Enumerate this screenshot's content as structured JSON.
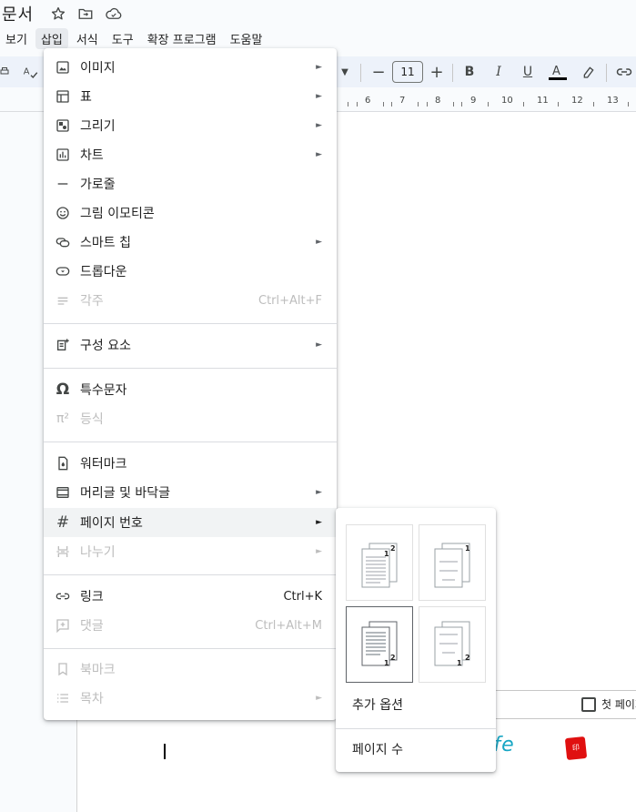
{
  "doc": {
    "title": "문서"
  },
  "menubar": {
    "items": [
      "보기",
      "삽입",
      "서식",
      "도구",
      "확장 프로그램",
      "도움말"
    ]
  },
  "toolbar": {
    "font_size": "11"
  },
  "ruler": {
    "numbers": [
      "6",
      "7",
      "8",
      "9",
      "10",
      "11",
      "12",
      "13"
    ]
  },
  "insert_menu": {
    "items": [
      {
        "label": "이미지",
        "icon": "image-icon",
        "arrow": "►"
      },
      {
        "label": "표",
        "icon": "table-icon",
        "arrow": "►"
      },
      {
        "label": "그리기",
        "icon": "drawing-icon",
        "arrow": "►"
      },
      {
        "label": "차트",
        "icon": "chart-icon",
        "arrow": "►"
      },
      {
        "label": "가로줄",
        "icon": "horizontal-line-icon"
      },
      {
        "label": "그림 이모티콘",
        "icon": "emoji-icon"
      },
      {
        "label": "스마트 칩",
        "icon": "smart-chip-icon",
        "arrow": "►"
      },
      {
        "label": "드롭다운",
        "icon": "dropdown-icon"
      },
      {
        "label": "각주",
        "icon": "footnote-icon",
        "shortcut": "Ctrl+Alt+F"
      },
      {
        "label": "구성 요소",
        "icon": "building-blocks-icon",
        "arrow": "►"
      },
      {
        "label": "특수문자",
        "icon": "omega-icon"
      },
      {
        "label": "등식",
        "icon": "pi-icon"
      },
      {
        "label": "워터마크",
        "icon": "watermark-icon"
      },
      {
        "label": "머리글 및 바닥글",
        "icon": "header-footer-icon",
        "arrow": "►"
      },
      {
        "label": "페이지 번호",
        "icon": "hash-icon",
        "arrow": "►"
      },
      {
        "label": "나누기",
        "icon": "break-icon",
        "arrow": "►"
      },
      {
        "label": "링크",
        "icon": "link-icon",
        "shortcut": "Ctrl+K"
      },
      {
        "label": "댓글",
        "icon": "comment-icon",
        "shortcut": "Ctrl+Alt+M"
      },
      {
        "label": "북마크",
        "icon": "bookmark-icon"
      },
      {
        "label": "목차",
        "icon": "toc-icon",
        "arrow": "►"
      }
    ]
  },
  "page_number_submenu": {
    "options": [
      {
        "pages": [
          "2",
          "1"
        ]
      },
      {
        "pages": [
          "1"
        ]
      },
      {
        "pages": [
          "2",
          "1"
        ]
      },
      {
        "pages": [
          "2",
          "1"
        ]
      }
    ],
    "more_options": "추가 옵션",
    "page_count": "페이지 수"
  },
  "footer": {
    "first_page_label": "첫 페이지"
  },
  "document_text": {
    "signature": "Life"
  }
}
